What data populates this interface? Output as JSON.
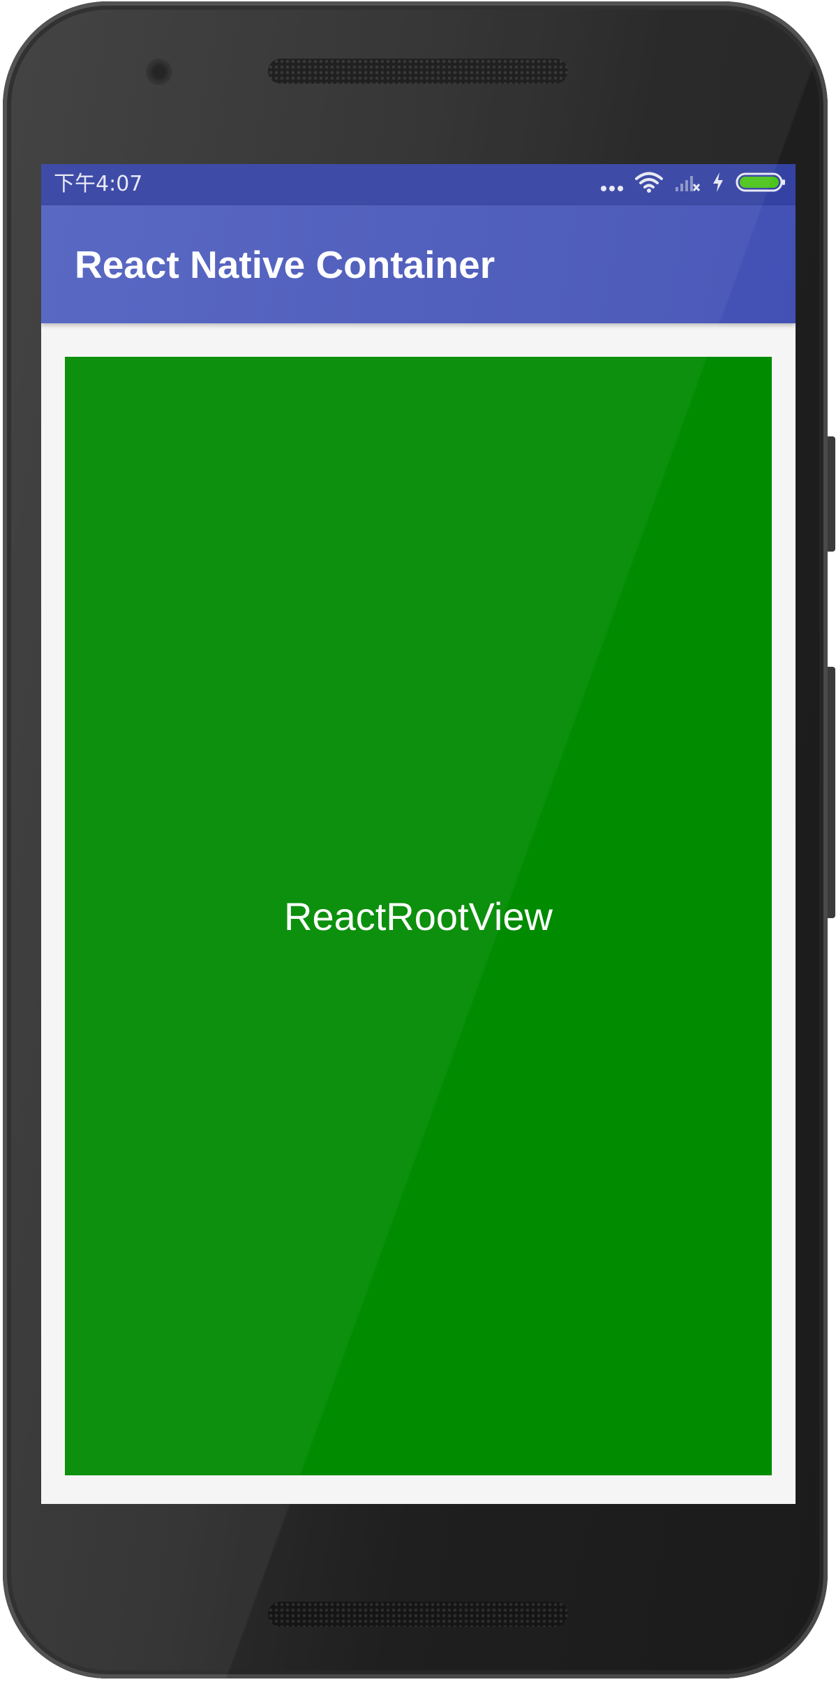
{
  "status_bar": {
    "time": "下午4:07",
    "icons": [
      "more-dots-icon",
      "wifi-icon",
      "signal-off-icon",
      "charging-icon",
      "battery-icon"
    ],
    "battery_color": "#4cc41c"
  },
  "app_bar": {
    "title": "React Native Container",
    "color": "#4351b5"
  },
  "content": {
    "root_view_label": "ReactRootView",
    "root_view_color": "#008b00"
  }
}
